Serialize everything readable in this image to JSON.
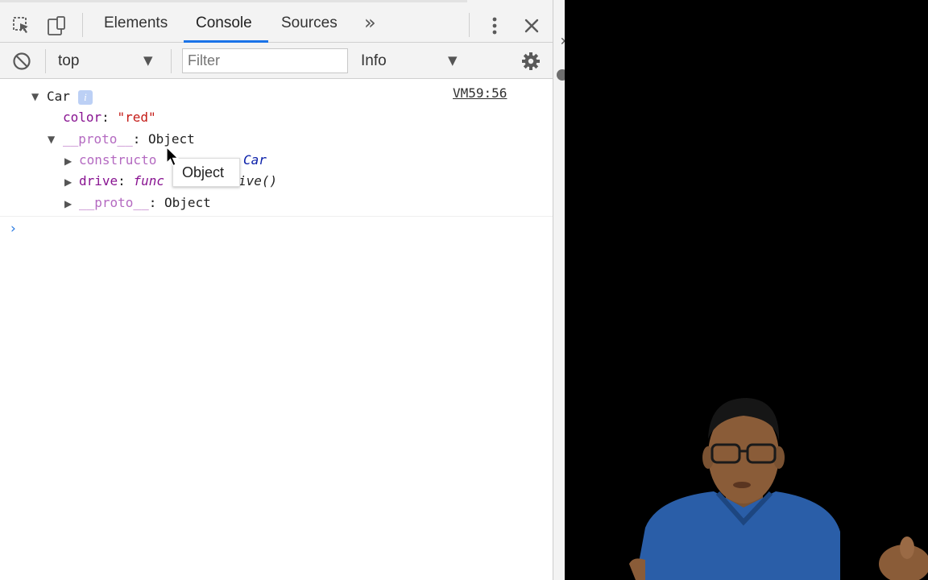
{
  "tabbar": {
    "icons": [
      "inspect-element-icon",
      "device-toolbar-icon",
      "more-tabs-chevron-icon",
      "kebab-menu-icon",
      "close-icon"
    ],
    "tabs": [
      {
        "label": "Elements",
        "active": false
      },
      {
        "label": "Console",
        "active": true
      },
      {
        "label": "Sources",
        "active": false
      }
    ],
    "more_tabs_glyph": "»",
    "active_underline_color": "#1a73e8"
  },
  "toolbar": {
    "context": "top",
    "filter_placeholder": "Filter",
    "level": "Info",
    "icons": [
      "clear-console-icon",
      "dropdown-arrow-icon",
      "settings-gear-icon"
    ]
  },
  "console": {
    "source_link": "VM59:56",
    "object_name": "Car",
    "info_badge": "i",
    "color_key": "color",
    "color_value": "\"red\"",
    "proto_key": "__proto__",
    "proto_value": "Object",
    "constructor_key": "constructo",
    "constructor_value": "Car",
    "drive_key": "drive",
    "drive_fn_keyword": "func",
    "drive_fn_name": "ive()",
    "nested_proto_key": "__proto__",
    "nested_proto_value": "Object",
    "prompt_glyph": "›",
    "colon": ":",
    "colon_space": ": "
  },
  "tooltip": {
    "text": "Object"
  },
  "colors": {
    "key": "#881391",
    "string": "#c41a16",
    "function": "#0d22aa",
    "prompt": "#2a7ae2"
  },
  "video": {
    "shirt_color": "#2a5ea8"
  }
}
